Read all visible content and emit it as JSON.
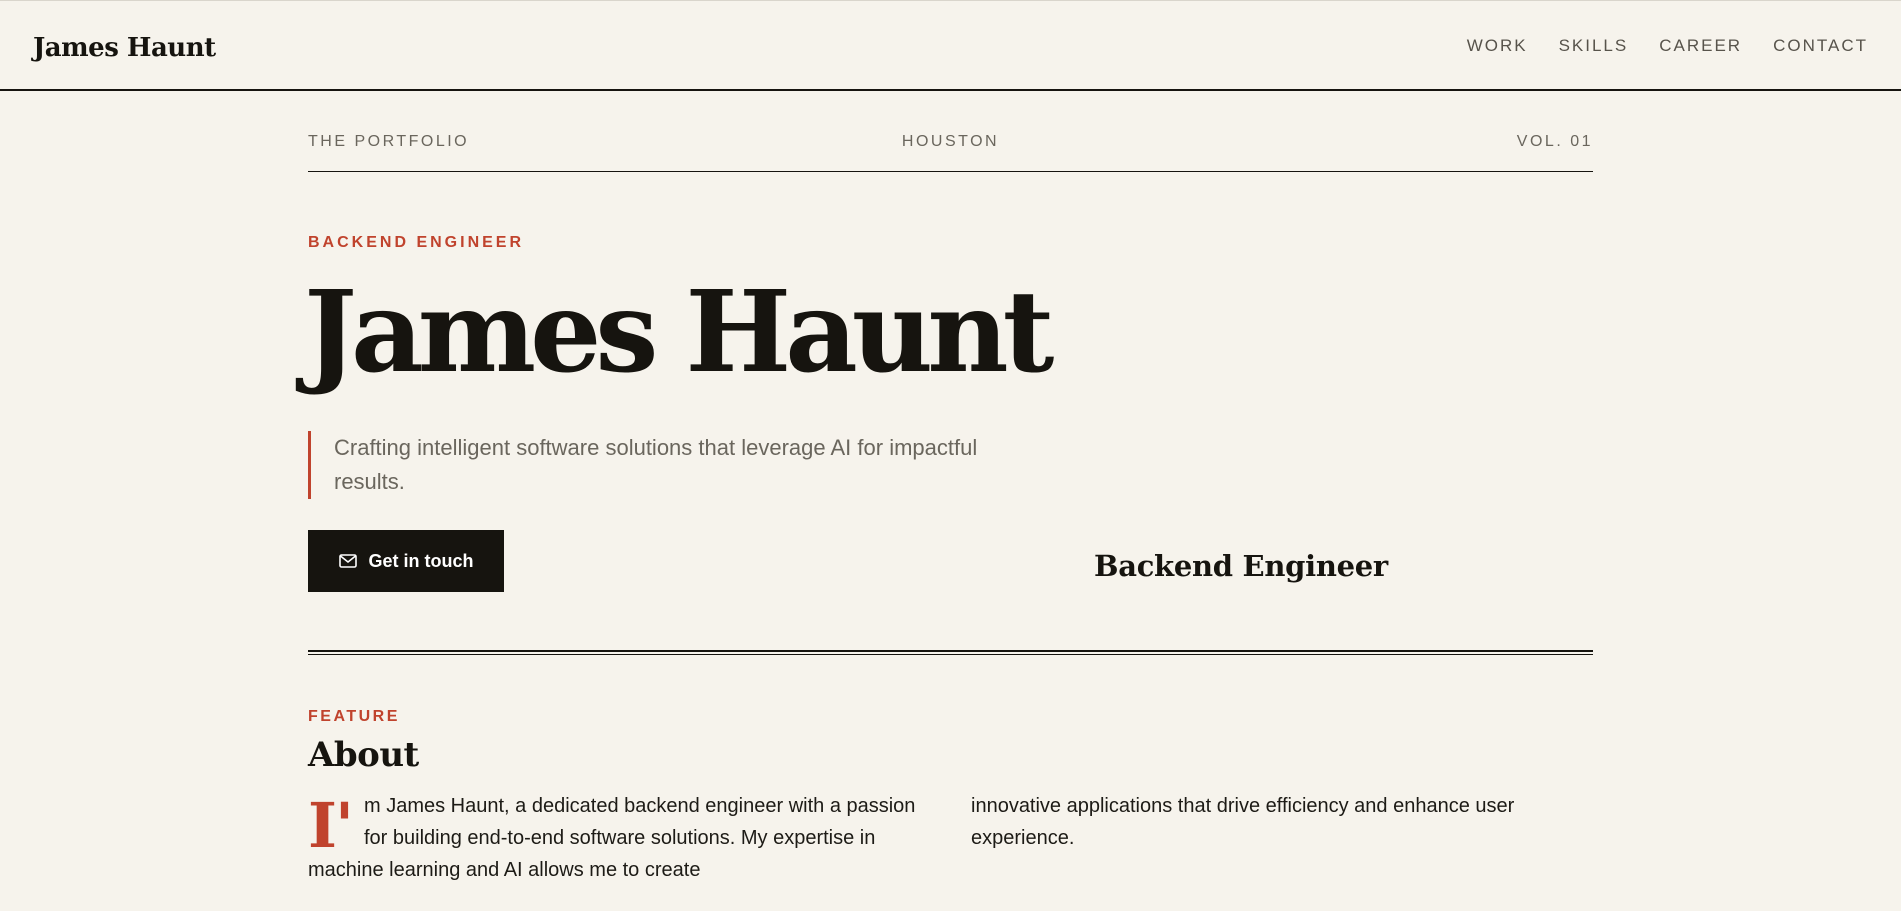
{
  "brand": "James Haunt",
  "nav": {
    "items": [
      "WORK",
      "SKILLS",
      "CAREER",
      "CONTACT"
    ]
  },
  "masthead": {
    "left": "THE PORTFOLIO",
    "center": "HOUSTON",
    "right": "VOL. 01"
  },
  "hero": {
    "eyebrow": "BACKEND ENGINEER",
    "name": "James Haunt",
    "tagline": "Crafting intelligent software solutions that leverage AI for impactful results.",
    "cta_label": "Get in touch",
    "cta_icon": "mail-icon",
    "role_title": "Backend Engineer"
  },
  "about": {
    "label": "FEATURE",
    "title": "About",
    "dropcap": "I'",
    "left_text": "m James Haunt, a dedicated backend engineer with a passion for building end-to-end software solutions. My expertise in machine learning and AI allows me to create",
    "right_text": "innovative applications that drive efficiency and enhance user experience."
  },
  "colors": {
    "background": "#f6f3ec",
    "ink": "#16140f",
    "accent": "#c0432d",
    "muted": "#6a665d"
  }
}
